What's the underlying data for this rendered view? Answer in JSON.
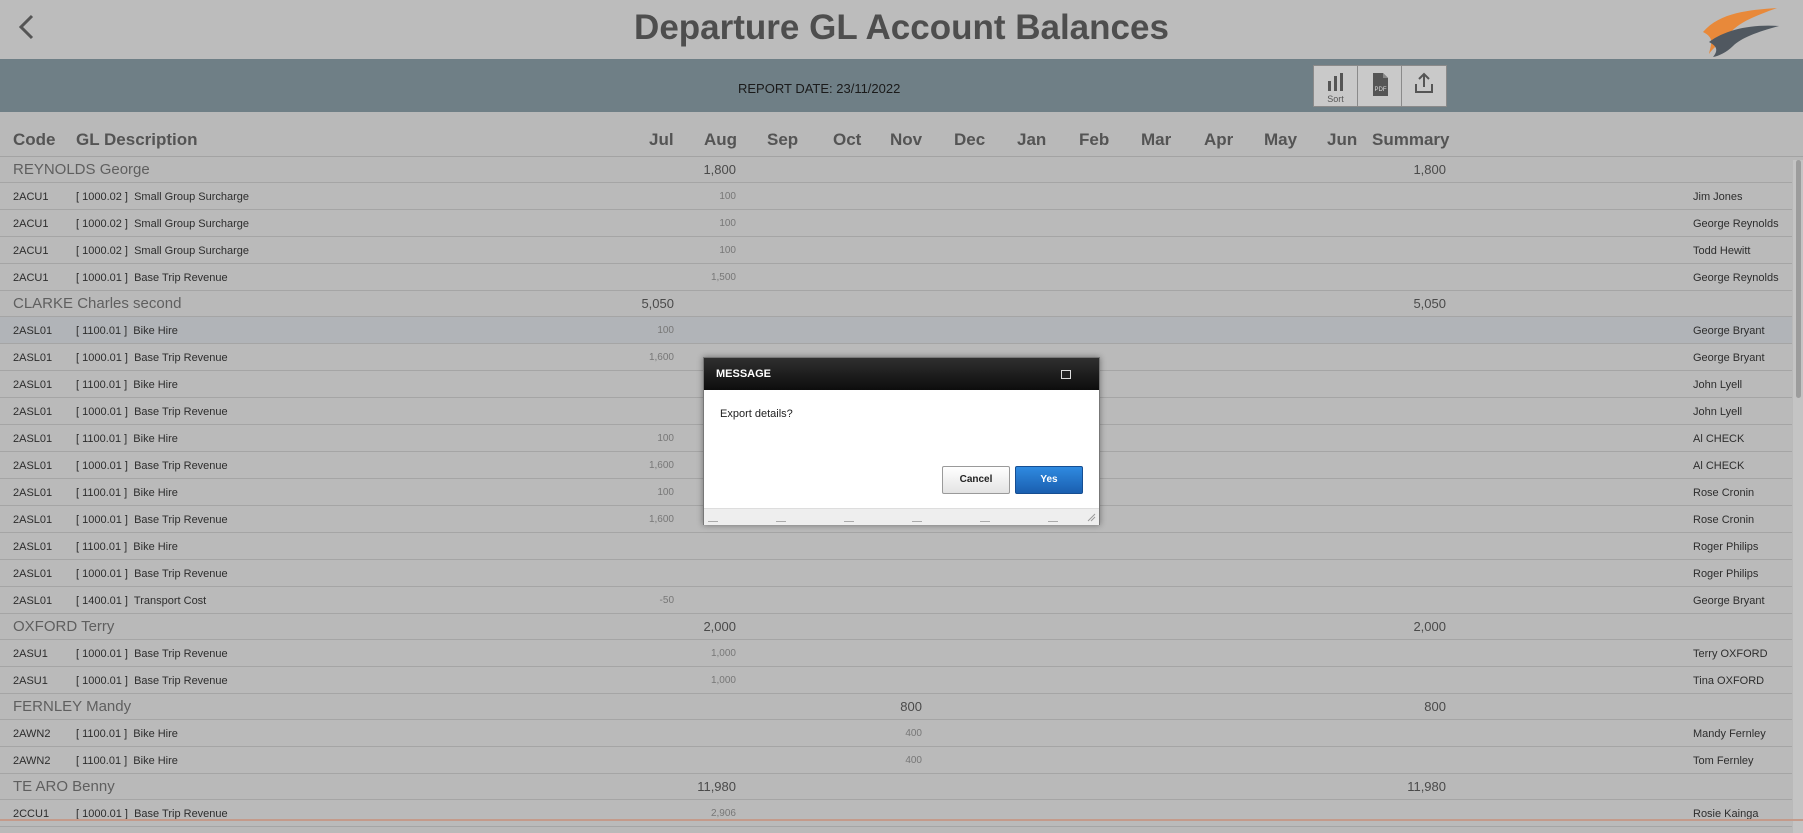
{
  "header": {
    "title": "Departure GL Account Balances"
  },
  "toolbar": {
    "report_date": "REPORT DATE: 23/11/2022",
    "sort_label": "Sort",
    "pdf_label": "PDF"
  },
  "columns": {
    "code": "Code",
    "description": "GL Description",
    "months": [
      "Jul",
      "Aug",
      "Sep",
      "Oct",
      "Nov",
      "Dec",
      "Jan",
      "Feb",
      "Mar",
      "Apr",
      "May",
      "Jun"
    ],
    "summary": "Summary"
  },
  "groups": [
    {
      "name": "REYNOLDS George",
      "col_value": "1,800",
      "summary": "1,800"
    },
    {
      "name": "CLARKE Charles second",
      "col_value": "5,050",
      "summary": "5,050"
    },
    {
      "name": "OXFORD Terry",
      "col_value": "2,000",
      "summary": "2,000"
    },
    {
      "name": "FERNLEY Mandy",
      "col_value": "800",
      "summary": "800"
    },
    {
      "name": "TE ARO Benny",
      "col_value": "11,980",
      "summary": "11,980"
    }
  ],
  "details": [
    {
      "code": "2ACU1",
      "desc": "[ 1000.02 ]  Small Group Surcharge",
      "value": "100",
      "who": "Jim Jones"
    },
    {
      "code": "2ACU1",
      "desc": "[ 1000.02 ]  Small Group Surcharge",
      "value": "100",
      "who": "George Reynolds"
    },
    {
      "code": "2ACU1",
      "desc": "[ 1000.02 ]  Small Group Surcharge",
      "value": "100",
      "who": "Todd Hewitt"
    },
    {
      "code": "2ACU1",
      "desc": "[ 1000.01 ]  Base Trip Revenue",
      "value": "1,500",
      "who": "George Reynolds"
    },
    {
      "code": "2ASL01",
      "desc": "[ 1100.01 ]  Bike Hire",
      "value": "100",
      "who": "George Bryant"
    },
    {
      "code": "2ASL01",
      "desc": "[ 1000.01 ]  Base Trip Revenue",
      "value": "1,600",
      "who": "George Bryant"
    },
    {
      "code": "2ASL01",
      "desc": "[ 1100.01 ]  Bike Hire",
      "value": "",
      "who": "John Lyell"
    },
    {
      "code": "2ASL01",
      "desc": "[ 1000.01 ]  Base Trip Revenue",
      "value": "",
      "who": "John Lyell"
    },
    {
      "code": "2ASL01",
      "desc": "[ 1100.01 ]  Bike Hire",
      "value": "100",
      "who": "Al CHECK"
    },
    {
      "code": "2ASL01",
      "desc": "[ 1000.01 ]  Base Trip Revenue",
      "value": "1,600",
      "who": "Al CHECK"
    },
    {
      "code": "2ASL01",
      "desc": "[ 1100.01 ]  Bike Hire",
      "value": "100",
      "who": "Rose Cronin"
    },
    {
      "code": "2ASL01",
      "desc": "[ 1000.01 ]  Base Trip Revenue",
      "value": "1,600",
      "who": "Rose Cronin"
    },
    {
      "code": "2ASL01",
      "desc": "[ 1100.01 ]  Bike Hire",
      "value": "",
      "who": "Roger Philips"
    },
    {
      "code": "2ASL01",
      "desc": "[ 1000.01 ]  Base Trip Revenue",
      "value": "",
      "who": "Roger Philips"
    },
    {
      "code": "2ASL01",
      "desc": "[ 1400.01 ]  Transport Cost",
      "value": "-50",
      "who": "George Bryant"
    },
    {
      "code": "2ASU1",
      "desc": "[ 1000.01 ]  Base Trip Revenue",
      "value": "1,000",
      "who": "Terry OXFORD"
    },
    {
      "code": "2ASU1",
      "desc": "[ 1000.01 ]  Base Trip Revenue",
      "value": "1,000",
      "who": "Tina OXFORD"
    },
    {
      "code": "2AWN2",
      "desc": "[ 1100.01 ]  Bike Hire",
      "value": "400",
      "who": "Mandy Fernley"
    },
    {
      "code": "2AWN2",
      "desc": "[ 1100.01 ]  Bike Hire",
      "value": "400",
      "who": "Tom Fernley"
    },
    {
      "code": "2CCU1",
      "desc": "[ 1000.01 ]  Base Trip Revenue",
      "value": "2,906",
      "who": "Rosie Kainga"
    }
  ],
  "dialog": {
    "title": "MESSAGE",
    "message": "Export details?",
    "cancel": "Cancel",
    "yes": "Yes"
  }
}
